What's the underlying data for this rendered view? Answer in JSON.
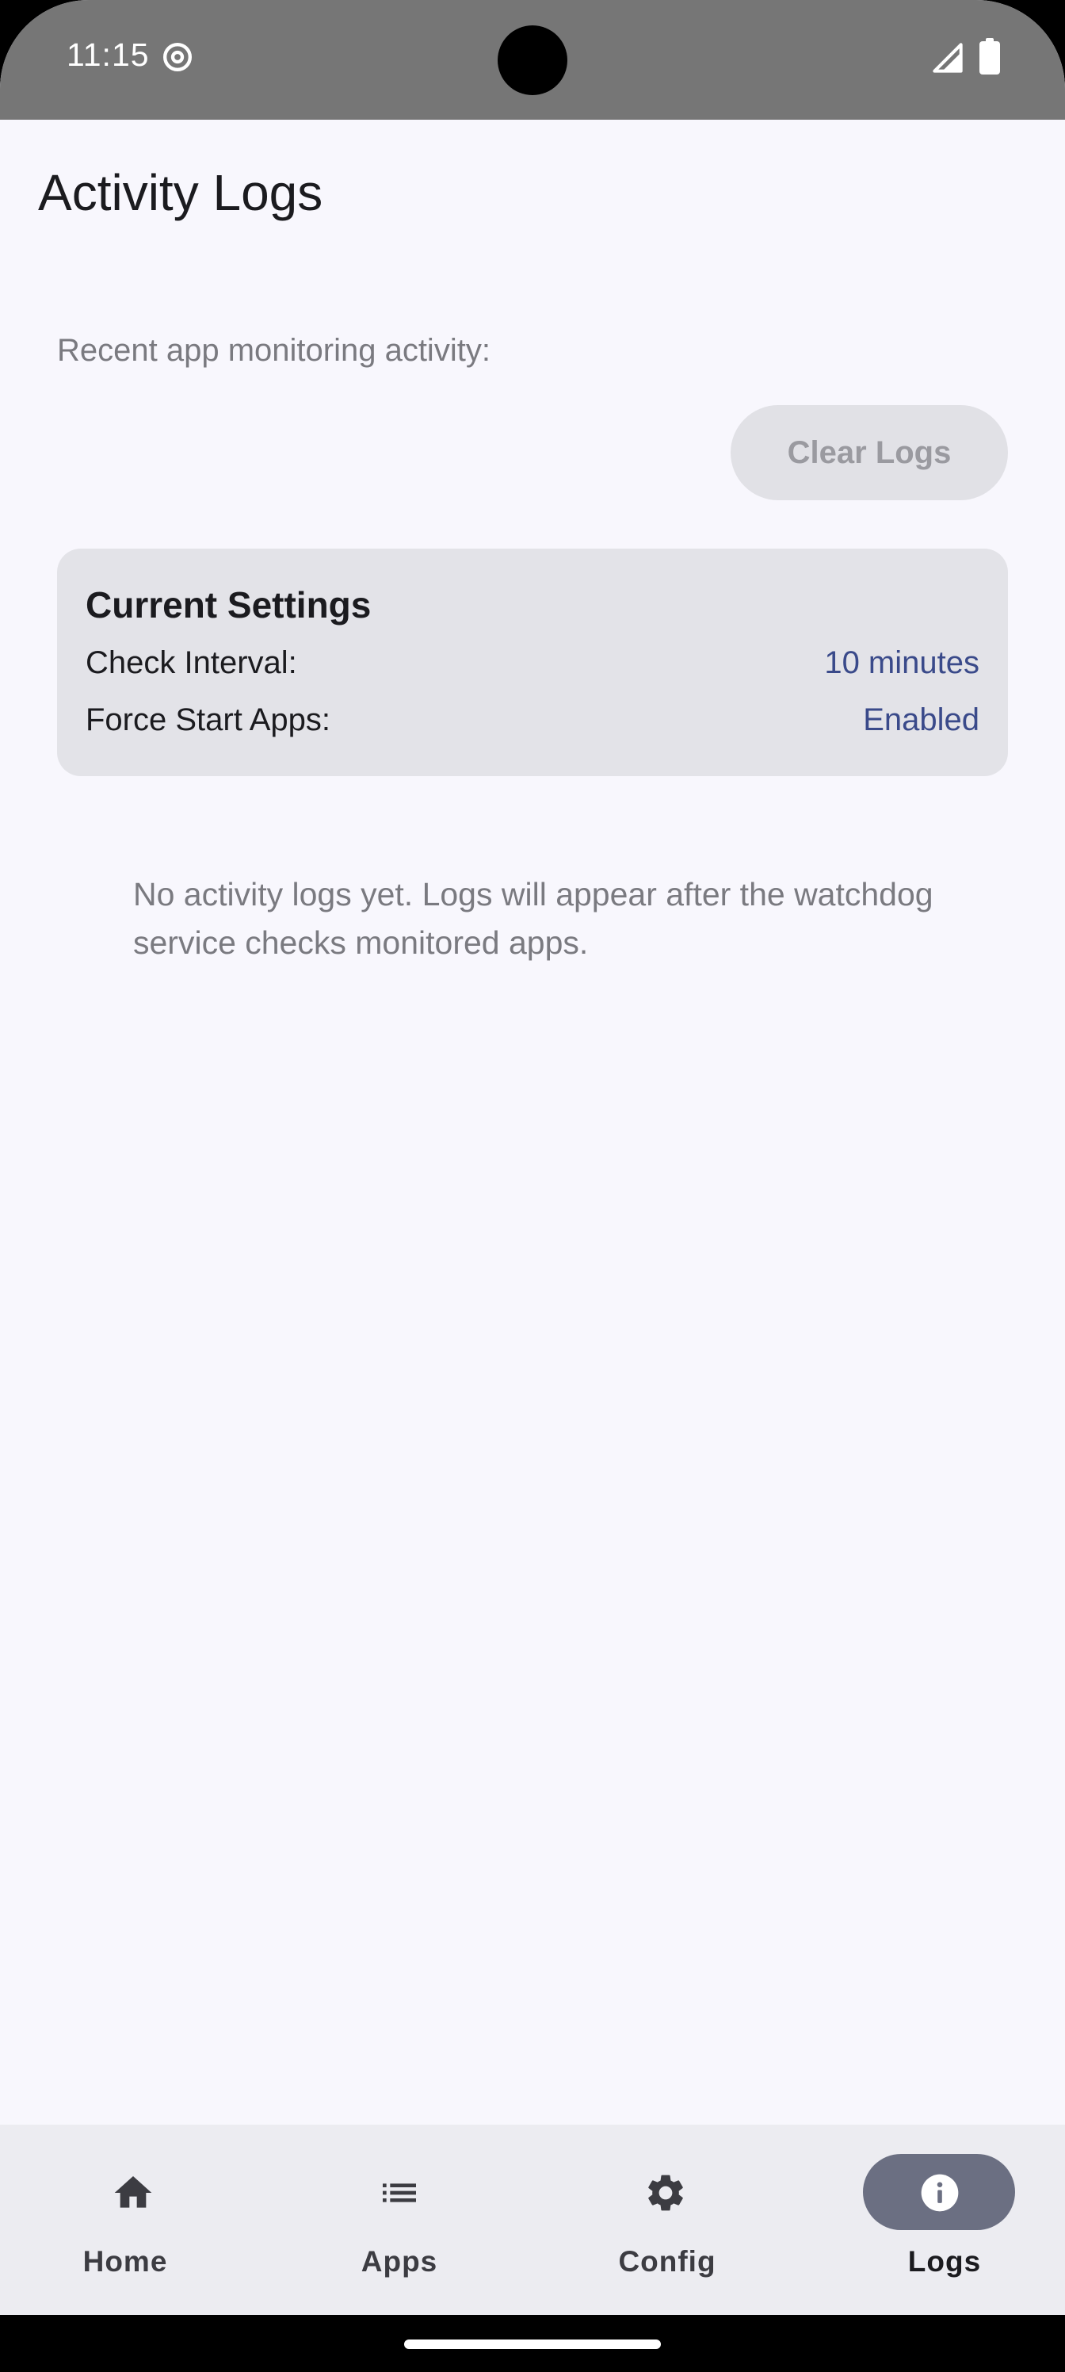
{
  "status_bar": {
    "time": "11:15",
    "icons": [
      "at-sign-icon",
      "signal-icon",
      "battery-icon"
    ]
  },
  "page": {
    "title": "Activity Logs",
    "subtitle": "Recent app monitoring activity:",
    "clear_button_label": "Clear Logs"
  },
  "settings_card": {
    "title": "Current Settings",
    "rows": [
      {
        "label": "Check Interval:",
        "value": "10 minutes"
      },
      {
        "label": "Force Start Apps:",
        "value": "Enabled"
      }
    ]
  },
  "empty_state": {
    "message": "No activity logs yet. Logs will appear after the watchdog service checks monitored apps."
  },
  "bottom_nav": {
    "items": [
      {
        "label": "Home",
        "icon": "home-icon",
        "selected": false
      },
      {
        "label": "Apps",
        "icon": "list-icon",
        "selected": false
      },
      {
        "label": "Config",
        "icon": "gear-icon",
        "selected": false
      },
      {
        "label": "Logs",
        "icon": "info-icon",
        "selected": true
      }
    ]
  },
  "colors": {
    "background": "#f8f7fd",
    "status_bar": "#767676",
    "card": "#e3e3e8",
    "accent_value": "#3a4a8a",
    "nav_background": "#ececf1",
    "nav_selected_pill": "#6b6f82",
    "button_disabled": "#e1e1e6"
  }
}
